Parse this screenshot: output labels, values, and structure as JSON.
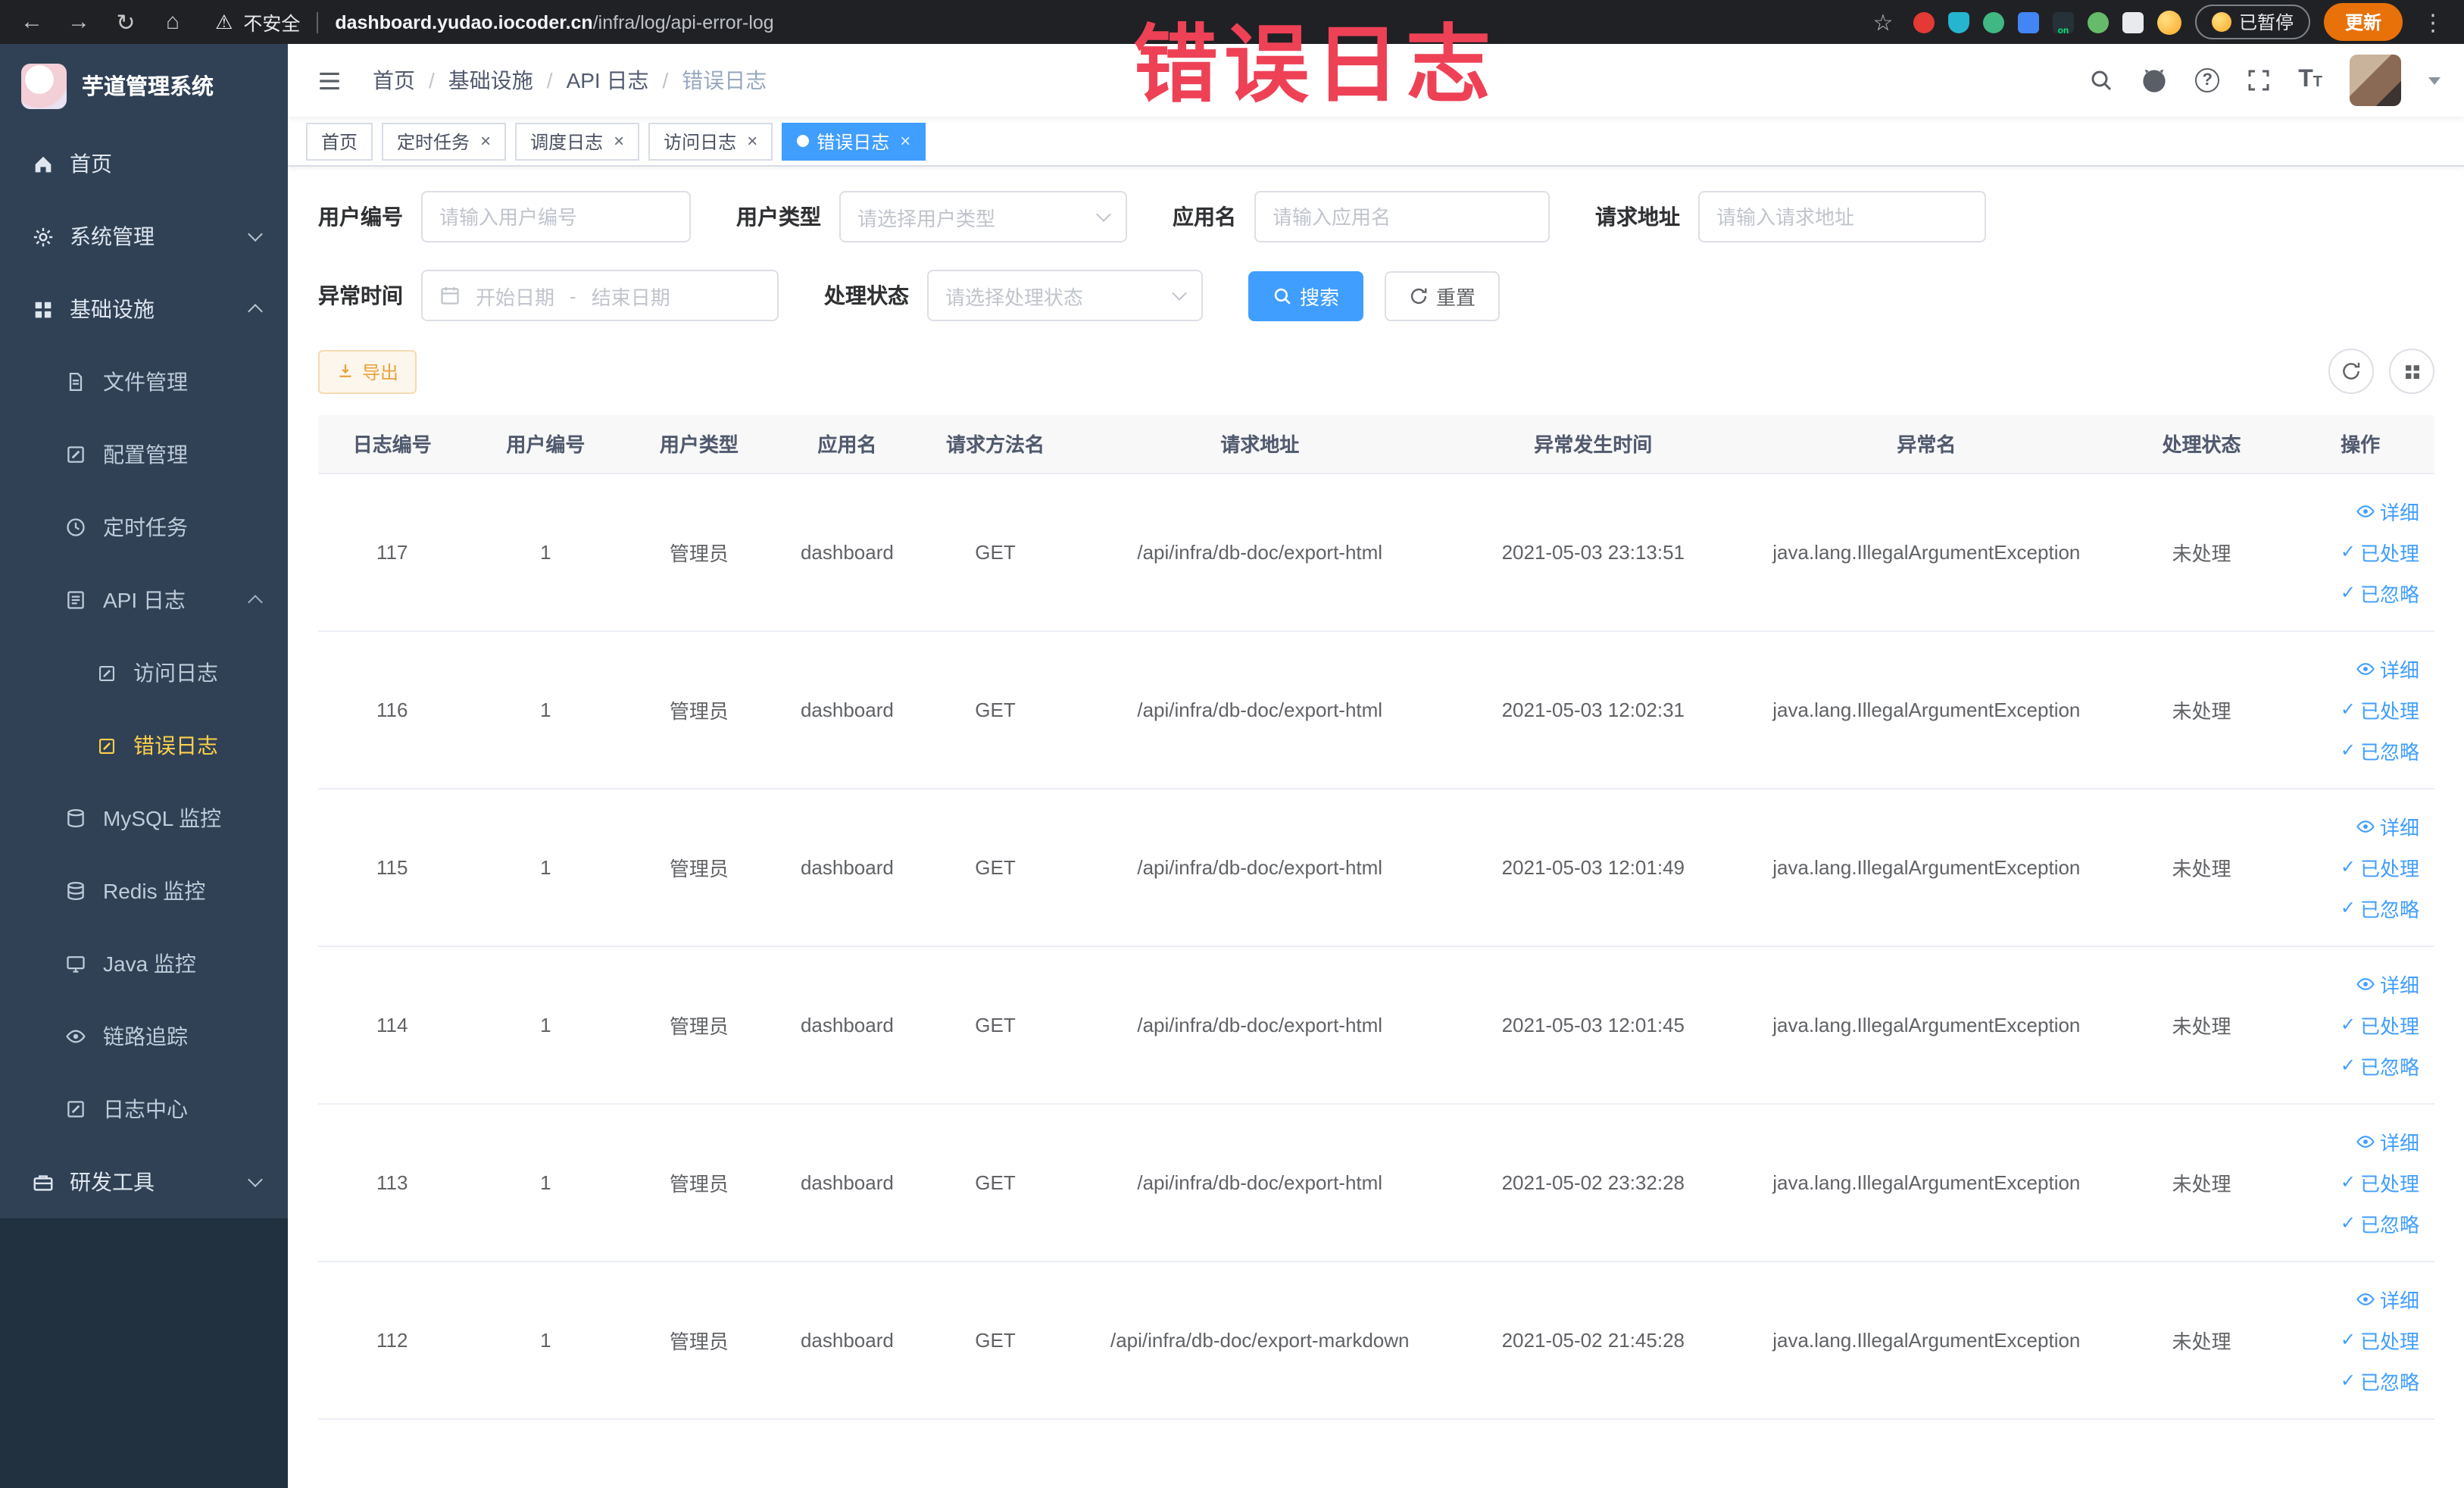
{
  "browser": {
    "security_label": "不安全",
    "url_domain": "dashboard.yudao.iocoder.cn",
    "url_path": "/infra/log/api-error-log",
    "paused_label": "已暂停",
    "update_label": "更新",
    "extension_badge": "on",
    "extension_colors": [
      "#e53935",
      "#26b5ce",
      "#41b883",
      "#4285f4",
      "#263238",
      "#66bb6a",
      "#e8eaed"
    ]
  },
  "icons": {
    "back": "←",
    "forward": "→",
    "reload": "↻",
    "home": "⌂",
    "warning": "⚠",
    "star": "☆",
    "menu_dots": "⋮",
    "close": "×",
    "check": "✓",
    "slash": "/",
    "help": "?",
    "font_size": "T"
  },
  "annotation": {
    "text": "错误日志",
    "color": "#ee4156"
  },
  "sidebar": {
    "logo_title": "芋道管理系统",
    "items": [
      {
        "label": "首页"
      },
      {
        "label": "系统管理"
      },
      {
        "label": "基础设施"
      },
      {
        "label": "文件管理"
      },
      {
        "label": "配置管理"
      },
      {
        "label": "定时任务"
      },
      {
        "label": "API 日志"
      },
      {
        "label": "访问日志"
      },
      {
        "label": "错误日志"
      },
      {
        "label": "MySQL 监控"
      },
      {
        "label": "Redis 监控"
      },
      {
        "label": "Java 监控"
      },
      {
        "label": "链路追踪"
      },
      {
        "label": "日志中心"
      },
      {
        "label": "研发工具"
      }
    ]
  },
  "breadcrumb": [
    "首页",
    "基础设施",
    "API 日志",
    "错误日志"
  ],
  "tabs": [
    {
      "label": "首页"
    },
    {
      "label": "定时任务"
    },
    {
      "label": "调度日志"
    },
    {
      "label": "访问日志"
    },
    {
      "label": "错误日志"
    }
  ],
  "filters": {
    "user_id": {
      "label": "用户编号",
      "placeholder": "请输入用户编号"
    },
    "user_type": {
      "label": "用户类型",
      "placeholder": "请选择用户类型"
    },
    "app_name": {
      "label": "应用名",
      "placeholder": "请输入应用名"
    },
    "request_url": {
      "label": "请求地址",
      "placeholder": "请输入请求地址"
    },
    "exception_time": {
      "label": "异常时间",
      "start_placeholder": "开始日期",
      "end_placeholder": "结束日期",
      "separator": "-"
    },
    "process_status": {
      "label": "处理状态",
      "placeholder": "请选择处理状态"
    },
    "search_label": "搜索",
    "reset_label": "重置"
  },
  "toolbar": {
    "export_label": "导出"
  },
  "table": {
    "columns": [
      "日志编号",
      "用户编号",
      "用户类型",
      "应用名",
      "请求方法名",
      "请求地址",
      "异常发生时间",
      "异常名",
      "处理状态",
      "操作"
    ],
    "actions": [
      "详细",
      "已处理",
      "已忽略"
    ],
    "rows": [
      {
        "id": "117",
        "user_id": "1",
        "user_type": "管理员",
        "app": "dashboard",
        "method": "GET",
        "url": "/api/infra/db-doc/export-html",
        "time": "2021-05-03 23:13:51",
        "exception": "java.lang.IllegalArgumentException",
        "status": "未处理"
      },
      {
        "id": "116",
        "user_id": "1",
        "user_type": "管理员",
        "app": "dashboard",
        "method": "GET",
        "url": "/api/infra/db-doc/export-html",
        "time": "2021-05-03 12:02:31",
        "exception": "java.lang.IllegalArgumentException",
        "status": "未处理"
      },
      {
        "id": "115",
        "user_id": "1",
        "user_type": "管理员",
        "app": "dashboard",
        "method": "GET",
        "url": "/api/infra/db-doc/export-html",
        "time": "2021-05-03 12:01:49",
        "exception": "java.lang.IllegalArgumentException",
        "status": "未处理"
      },
      {
        "id": "114",
        "user_id": "1",
        "user_type": "管理员",
        "app": "dashboard",
        "method": "GET",
        "url": "/api/infra/db-doc/export-html",
        "time": "2021-05-03 12:01:45",
        "exception": "java.lang.IllegalArgumentException",
        "status": "未处理"
      },
      {
        "id": "113",
        "user_id": "1",
        "user_type": "管理员",
        "app": "dashboard",
        "method": "GET",
        "url": "/api/infra/db-doc/export-html",
        "time": "2021-05-02 23:32:28",
        "exception": "java.lang.IllegalArgumentException",
        "status": "未处理"
      },
      {
        "id": "112",
        "user_id": "1",
        "user_type": "管理员",
        "app": "dashboard",
        "method": "GET",
        "url": "/api/infra/db-doc/export-markdown",
        "time": "2021-05-02 21:45:28",
        "exception": "java.lang.IllegalArgumentException",
        "status": "未处理"
      }
    ]
  },
  "colors": {
    "accent": "#409eff",
    "sidebar_bg": "#304156",
    "active_menu": "#ffd04b",
    "warning": "#e6a23c",
    "annotation_red": "#ee4156"
  }
}
